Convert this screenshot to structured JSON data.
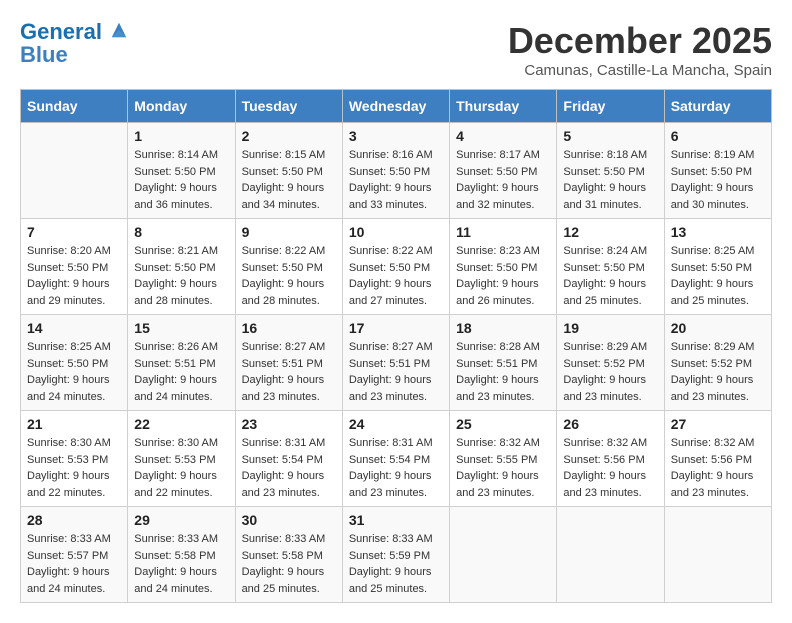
{
  "logo": {
    "line1": "General",
    "line2": "Blue"
  },
  "title": "December 2025",
  "location": "Camunas, Castille-La Mancha, Spain",
  "days_of_week": [
    "Sunday",
    "Monday",
    "Tuesday",
    "Wednesday",
    "Thursday",
    "Friday",
    "Saturday"
  ],
  "weeks": [
    [
      {
        "day": "",
        "info": ""
      },
      {
        "day": "1",
        "info": "Sunrise: 8:14 AM\nSunset: 5:50 PM\nDaylight: 9 hours\nand 36 minutes."
      },
      {
        "day": "2",
        "info": "Sunrise: 8:15 AM\nSunset: 5:50 PM\nDaylight: 9 hours\nand 34 minutes."
      },
      {
        "day": "3",
        "info": "Sunrise: 8:16 AM\nSunset: 5:50 PM\nDaylight: 9 hours\nand 33 minutes."
      },
      {
        "day": "4",
        "info": "Sunrise: 8:17 AM\nSunset: 5:50 PM\nDaylight: 9 hours\nand 32 minutes."
      },
      {
        "day": "5",
        "info": "Sunrise: 8:18 AM\nSunset: 5:50 PM\nDaylight: 9 hours\nand 31 minutes."
      },
      {
        "day": "6",
        "info": "Sunrise: 8:19 AM\nSunset: 5:50 PM\nDaylight: 9 hours\nand 30 minutes."
      }
    ],
    [
      {
        "day": "7",
        "info": "Sunrise: 8:20 AM\nSunset: 5:50 PM\nDaylight: 9 hours\nand 29 minutes."
      },
      {
        "day": "8",
        "info": "Sunrise: 8:21 AM\nSunset: 5:50 PM\nDaylight: 9 hours\nand 28 minutes."
      },
      {
        "day": "9",
        "info": "Sunrise: 8:22 AM\nSunset: 5:50 PM\nDaylight: 9 hours\nand 28 minutes."
      },
      {
        "day": "10",
        "info": "Sunrise: 8:22 AM\nSunset: 5:50 PM\nDaylight: 9 hours\nand 27 minutes."
      },
      {
        "day": "11",
        "info": "Sunrise: 8:23 AM\nSunset: 5:50 PM\nDaylight: 9 hours\nand 26 minutes."
      },
      {
        "day": "12",
        "info": "Sunrise: 8:24 AM\nSunset: 5:50 PM\nDaylight: 9 hours\nand 25 minutes."
      },
      {
        "day": "13",
        "info": "Sunrise: 8:25 AM\nSunset: 5:50 PM\nDaylight: 9 hours\nand 25 minutes."
      }
    ],
    [
      {
        "day": "14",
        "info": "Sunrise: 8:25 AM\nSunset: 5:50 PM\nDaylight: 9 hours\nand 24 minutes."
      },
      {
        "day": "15",
        "info": "Sunrise: 8:26 AM\nSunset: 5:51 PM\nDaylight: 9 hours\nand 24 minutes."
      },
      {
        "day": "16",
        "info": "Sunrise: 8:27 AM\nSunset: 5:51 PM\nDaylight: 9 hours\nand 23 minutes."
      },
      {
        "day": "17",
        "info": "Sunrise: 8:27 AM\nSunset: 5:51 PM\nDaylight: 9 hours\nand 23 minutes."
      },
      {
        "day": "18",
        "info": "Sunrise: 8:28 AM\nSunset: 5:51 PM\nDaylight: 9 hours\nand 23 minutes."
      },
      {
        "day": "19",
        "info": "Sunrise: 8:29 AM\nSunset: 5:52 PM\nDaylight: 9 hours\nand 23 minutes."
      },
      {
        "day": "20",
        "info": "Sunrise: 8:29 AM\nSunset: 5:52 PM\nDaylight: 9 hours\nand 23 minutes."
      }
    ],
    [
      {
        "day": "21",
        "info": "Sunrise: 8:30 AM\nSunset: 5:53 PM\nDaylight: 9 hours\nand 22 minutes."
      },
      {
        "day": "22",
        "info": "Sunrise: 8:30 AM\nSunset: 5:53 PM\nDaylight: 9 hours\nand 22 minutes."
      },
      {
        "day": "23",
        "info": "Sunrise: 8:31 AM\nSunset: 5:54 PM\nDaylight: 9 hours\nand 23 minutes."
      },
      {
        "day": "24",
        "info": "Sunrise: 8:31 AM\nSunset: 5:54 PM\nDaylight: 9 hours\nand 23 minutes."
      },
      {
        "day": "25",
        "info": "Sunrise: 8:32 AM\nSunset: 5:55 PM\nDaylight: 9 hours\nand 23 minutes."
      },
      {
        "day": "26",
        "info": "Sunrise: 8:32 AM\nSunset: 5:56 PM\nDaylight: 9 hours\nand 23 minutes."
      },
      {
        "day": "27",
        "info": "Sunrise: 8:32 AM\nSunset: 5:56 PM\nDaylight: 9 hours\nand 23 minutes."
      }
    ],
    [
      {
        "day": "28",
        "info": "Sunrise: 8:33 AM\nSunset: 5:57 PM\nDaylight: 9 hours\nand 24 minutes."
      },
      {
        "day": "29",
        "info": "Sunrise: 8:33 AM\nSunset: 5:58 PM\nDaylight: 9 hours\nand 24 minutes."
      },
      {
        "day": "30",
        "info": "Sunrise: 8:33 AM\nSunset: 5:58 PM\nDaylight: 9 hours\nand 25 minutes."
      },
      {
        "day": "31",
        "info": "Sunrise: 8:33 AM\nSunset: 5:59 PM\nDaylight: 9 hours\nand 25 minutes."
      },
      {
        "day": "",
        "info": ""
      },
      {
        "day": "",
        "info": ""
      },
      {
        "day": "",
        "info": ""
      }
    ]
  ]
}
